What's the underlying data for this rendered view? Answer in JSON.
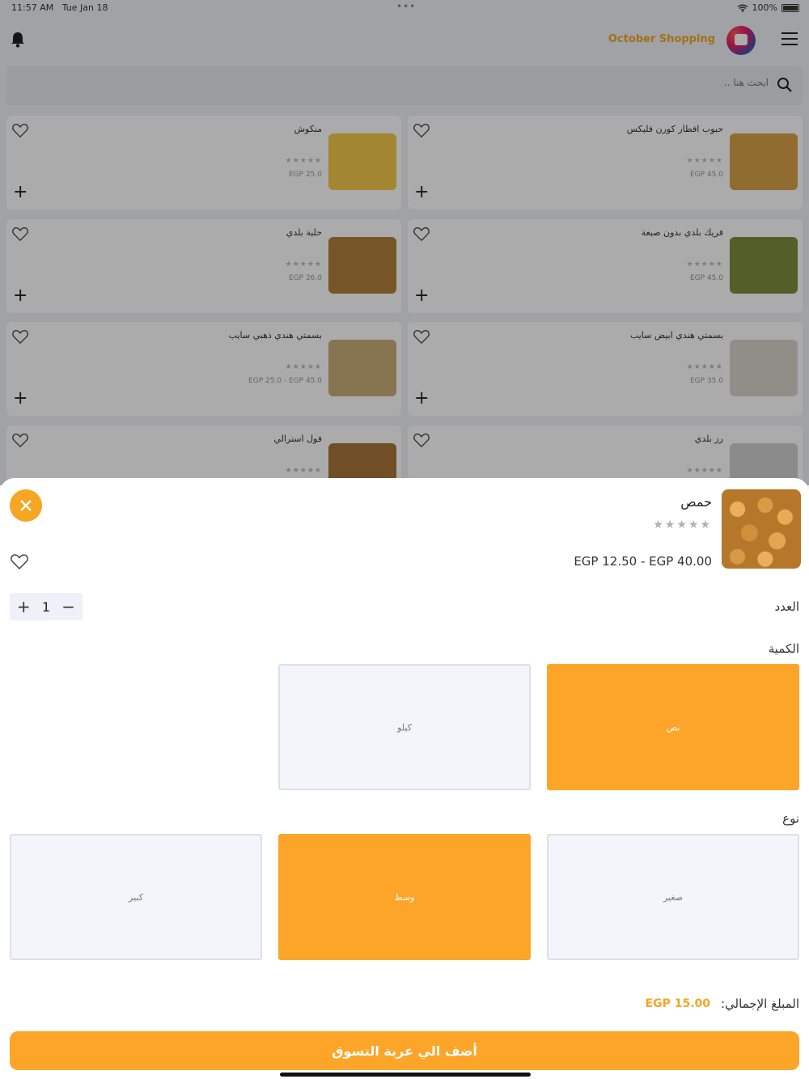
{
  "status_bar": {
    "time": "11:57 AM",
    "date": "Tue Jan 18",
    "battery": "100%"
  },
  "header": {
    "brand": "October Shopping"
  },
  "search": {
    "placeholder": "ابحث هنا .."
  },
  "products": [
    {
      "name": "حبوب افطار كورن فليكس",
      "stars": "★★★★★",
      "price": "EGP 45.0",
      "color": "#d9a24a"
    },
    {
      "name": "منكوش",
      "stars": "★★★★★",
      "price": "EGP 25.0",
      "color": "#f3c84a"
    },
    {
      "name": "فريك بلدي بدون صبغة",
      "stars": "★★★★★",
      "price": "EGP 45.0",
      "color": "#7d8c3c"
    },
    {
      "name": "حلبة بلدي",
      "stars": "★★★★★",
      "price": "EGP 26.0",
      "color": "#b07f3a"
    },
    {
      "name": "بسمتي هندي ابيض سايب",
      "stars": "★★★★★",
      "price": "EGP 35.0",
      "color": "#d8d4cc"
    },
    {
      "name": "بسمتي هندي ذهبي سايب",
      "stars": "★★★★★",
      "price": "EGP 25.0 - EGP 45.0",
      "color": "#c9ad7a"
    },
    {
      "name": "رز بلدي",
      "stars": "★★★★★",
      "price": "",
      "color": "#cfcfcf"
    },
    {
      "name": "فول استرالي",
      "stars": "★★★★★",
      "price": "",
      "color": "#a8763a"
    }
  ],
  "sheet": {
    "product_name": "حمص",
    "stars": "★★★★★",
    "price": "EGP 12.50 - EGP 40.00",
    "quantity_label": "العدد",
    "quantity": "1",
    "amount_label": "الكمية",
    "amount_options": [
      {
        "label": "نص",
        "selected": true
      },
      {
        "label": "كيلو",
        "selected": false
      }
    ],
    "type_label": "نوع",
    "type_options": [
      {
        "label": "صغير",
        "selected": false
      },
      {
        "label": "وسط",
        "selected": true
      },
      {
        "label": "كبير",
        "selected": false
      }
    ],
    "total_label": "المبلغ الإجمالي:",
    "total_value": "EGP 15.00",
    "add_to_cart": "أضف الي عربة التسوق"
  },
  "colors": {
    "accent": "#fca528",
    "brand": "#f5a623"
  }
}
